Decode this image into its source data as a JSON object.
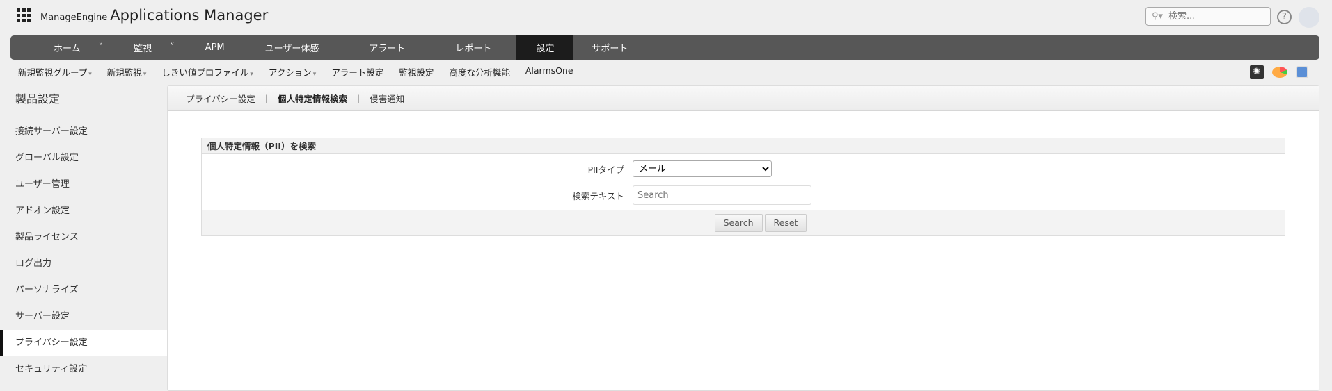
{
  "header": {
    "brand_small": "ManageEngine",
    "brand_title": "Applications Manager",
    "search_placeholder": "検索..."
  },
  "nav": [
    {
      "label": "ホーム",
      "caret": "˅"
    },
    {
      "label": "監視",
      "caret": "˅"
    },
    {
      "label": "APM"
    },
    {
      "label": "ユーザー体感"
    },
    {
      "label": "アラート"
    },
    {
      "label": "レポート"
    },
    {
      "label": "設定",
      "active": true
    },
    {
      "label": "サポート"
    }
  ],
  "subnav": [
    {
      "label": "新規監視グループ",
      "caret": "▾"
    },
    {
      "label": "新規監視",
      "caret": "▾"
    },
    {
      "label": "しきい値プロファイル",
      "caret": "▾"
    },
    {
      "label": "アクション",
      "caret": "▾"
    },
    {
      "label": "アラート設定"
    },
    {
      "label": "監視設定"
    },
    {
      "label": "高度な分析機能"
    },
    {
      "label": "AlarmsOne"
    }
  ],
  "sidebar": {
    "title": "製品設定",
    "items": [
      "接続サーバー設定",
      "グローバル設定",
      "ユーザー管理",
      "アドオン設定",
      "製品ライセンス",
      "ログ出力",
      "パーソナライズ",
      "サーバー設定",
      "プライバシー設定",
      "セキュリティ設定"
    ]
  },
  "tabs": {
    "t0": "プライバシー設定",
    "t1": "個人特定情報検索",
    "t2": "侵害通知",
    "sep": "|"
  },
  "form": {
    "title": "個人特定情報（PII）を検索",
    "pii_label": "PIIタイプ",
    "pii_value": "メール",
    "text_label": "検索テキスト",
    "text_placeholder": "Search",
    "search_btn": "Search",
    "reset_btn": "Reset"
  }
}
